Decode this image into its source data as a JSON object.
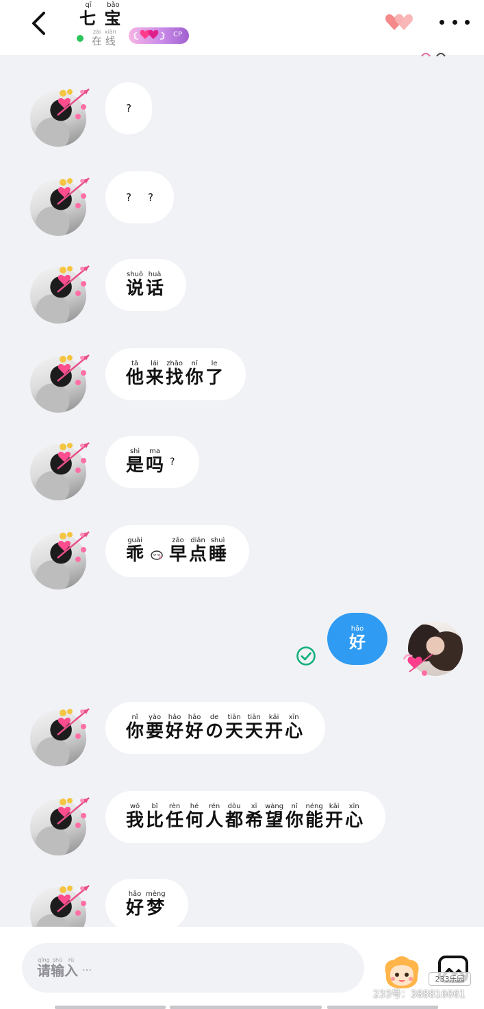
{
  "header": {
    "title": "七宝",
    "title_pinyin": [
      "qī",
      "bǎo"
    ],
    "title_chars": [
      "七",
      "宝"
    ],
    "status_chars": [
      "在",
      "线"
    ],
    "status_pinyin": [
      "zài",
      "xiàn"
    ],
    "cp_label": "CP"
  },
  "messages": [
    {
      "side": "left",
      "tokens": [
        {
          "t": "?"
        }
      ]
    },
    {
      "side": "left",
      "tokens": [
        {
          "t": "?"
        },
        {
          "t": "?"
        }
      ]
    },
    {
      "side": "left",
      "tokens": [
        {
          "c": "说",
          "p": "shuō"
        },
        {
          "c": "话",
          "p": "huà"
        }
      ]
    },
    {
      "side": "left",
      "tokens": [
        {
          "c": "他",
          "p": "tā"
        },
        {
          "c": "来",
          "p": "lái"
        },
        {
          "c": "找",
          "p": "zhǎo"
        },
        {
          "c": "你",
          "p": "nǐ"
        },
        {
          "c": "了",
          "p": "le"
        }
      ]
    },
    {
      "side": "left",
      "tokens": [
        {
          "c": "是",
          "p": "shì"
        },
        {
          "c": "吗",
          "p": "ma"
        },
        {
          "t": "?"
        }
      ]
    },
    {
      "side": "left",
      "tokens": [
        {
          "c": "乖",
          "p": "guāi"
        },
        {
          "emoji": "sleep-emoji"
        },
        {
          "c": "早",
          "p": "zǎo"
        },
        {
          "c": "点",
          "p": "diǎn"
        },
        {
          "c": "睡",
          "p": "shuì"
        }
      ]
    },
    {
      "side": "right",
      "tokens": [
        {
          "c": "好",
          "p": "hǎo"
        }
      ]
    },
    {
      "side": "left",
      "tokens": [
        {
          "c": "你",
          "p": "nǐ"
        },
        {
          "c": "要",
          "p": "yào"
        },
        {
          "c": "好",
          "p": "hǎo"
        },
        {
          "c": "好",
          "p": "hǎo"
        },
        {
          "c": "の",
          "p": "de"
        },
        {
          "c": "天",
          "p": "tiān"
        },
        {
          "c": "天",
          "p": "tiān"
        },
        {
          "c": "开",
          "p": "kāi"
        },
        {
          "c": "心",
          "p": "xīn"
        }
      ]
    },
    {
      "side": "left",
      "tokens": [
        {
          "c": "我",
          "p": "wǒ"
        },
        {
          "c": "比",
          "p": "bǐ"
        },
        {
          "c": "任",
          "p": "rèn"
        },
        {
          "c": "何",
          "p": "hé"
        },
        {
          "c": "人",
          "p": "rén"
        },
        {
          "c": "都",
          "p": "dōu"
        },
        {
          "c": "希",
          "p": "xī"
        },
        {
          "c": "望",
          "p": "wàng"
        },
        {
          "c": "你",
          "p": "nǐ"
        },
        {
          "c": "能",
          "p": "néng"
        },
        {
          "c": "开",
          "p": "kāi"
        },
        {
          "c": "心",
          "p": "xīn"
        }
      ]
    },
    {
      "side": "left",
      "tokens": [
        {
          "c": "好",
          "p": "hǎo"
        },
        {
          "c": "梦",
          "p": "mèng"
        }
      ]
    }
  ],
  "input": {
    "placeholder_chars": [
      "请",
      "输",
      "入"
    ],
    "placeholder_pinyin": [
      "qǐng",
      "shū",
      "rù"
    ],
    "placeholder_suffix": "…"
  },
  "watermark": {
    "text": "233号：388816061",
    "logo": "233乐园"
  },
  "colors": {
    "accent_blue": "#2f9bf2",
    "online_green": "#2cc55a",
    "read_check_green": "#12b07a",
    "background": "#f1f2f6"
  },
  "icons": [
    "back-arrow-icon",
    "couple-hearts-icon",
    "more-dots-icon",
    "read-check-icon",
    "emoji-mascot-icon",
    "image-icon"
  ]
}
